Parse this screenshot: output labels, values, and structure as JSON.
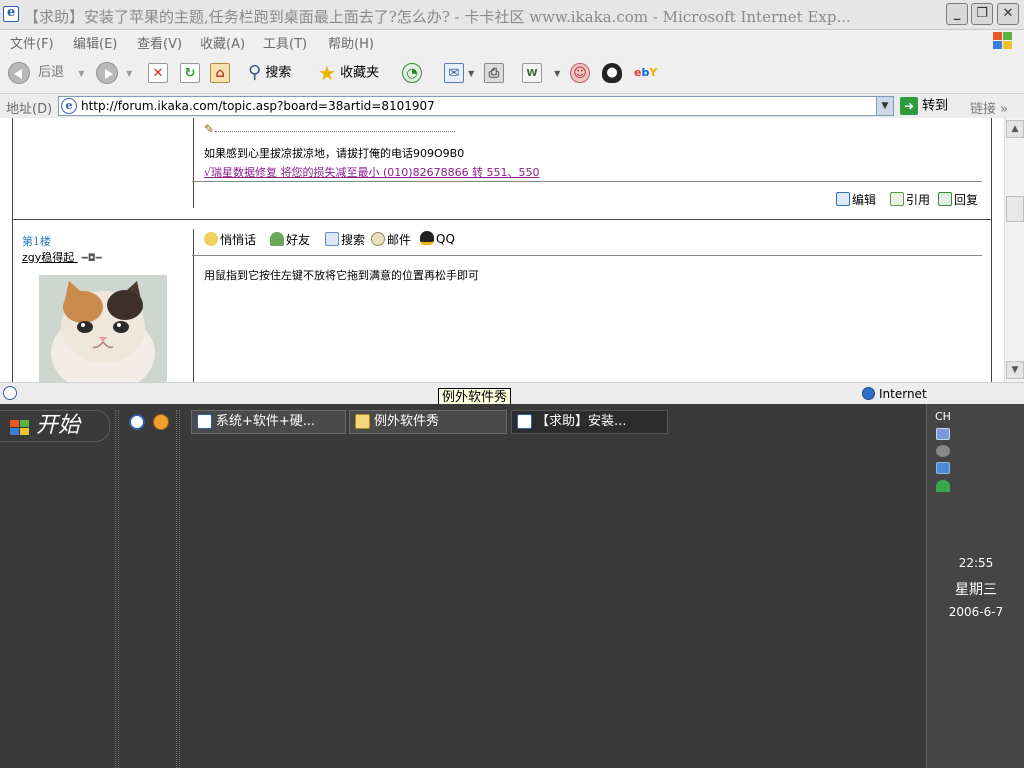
{
  "window": {
    "title": "【求助】安装了苹果的主题,任务栏跑到桌面最上面去了?怎么办? - 卡卡社区 www.ikaka.com - Microsoft Internet Exp...",
    "minimize_glyph": "_",
    "maximize_glyph": "❐",
    "close_glyph": "✕"
  },
  "menu": {
    "items": [
      "文件(F)",
      "编辑(E)",
      "查看(V)",
      "收藏(A)",
      "工具(T)",
      "帮助(H)"
    ]
  },
  "toolbar": {
    "back_label": "后退",
    "search_label": "搜索",
    "favorites_label": "收藏夹"
  },
  "address": {
    "label": "地址(D)",
    "url": "http://forum.ikaka.com/topic.asp?board=38artid=8101907",
    "go_label": "转到",
    "links_label": "链接"
  },
  "post_prev": {
    "signature_line": "如果感到心里拔凉拔凉地，请拔打俺的电话909O9B0",
    "signature_link": "√瑞星数据修复 将您的损失减至最小 (010)82678866 转 551、550",
    "actions": [
      "编辑",
      "引用",
      "回复"
    ]
  },
  "post_1": {
    "floor": "第1楼",
    "username": "zgy稳得起",
    "tools": [
      "悄悄话",
      "好友",
      "搜索",
      "邮件",
      "QQ"
    ],
    "body": "用鼠指到它按住左键不放将它拖到满意的位置再松手即可"
  },
  "status": {
    "zone": "Internet",
    "tooltip": "例外软件秀"
  },
  "taskbar": {
    "start_label": "开始",
    "tasks": [
      "系统+软件+硬...",
      "例外软件秀",
      "【求助】安装..."
    ],
    "lang": "CH",
    "time": "22:55",
    "weekday": "星期三",
    "date": "2006-6-7"
  },
  "colors": {
    "accent": "#2f5fae",
    "link_purple": "#8a1e8a",
    "floor_blue": "#2a7fc0",
    "taskbar_bg": "#3a3a3a"
  }
}
